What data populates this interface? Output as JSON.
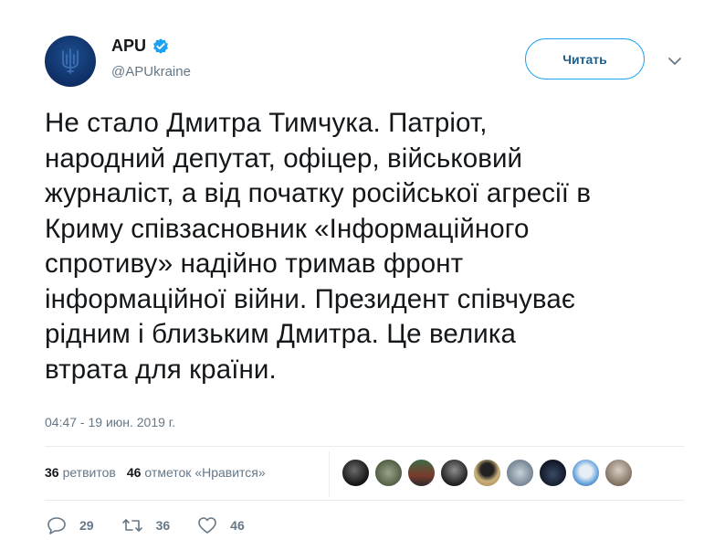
{
  "account": {
    "name": "APU",
    "handle": "@APUkraine",
    "verified": true,
    "avatar_icon": "trident-emblem-icon"
  },
  "follow_button": {
    "label": "Читать"
  },
  "tweet": {
    "text": "Не стало Дмитра Тимчука. Патріот,\nнародний депутат, офіцер, військовий\nжурналіст, а від початку російської агресії в\nКриму співзасновник «Інформаційного\nспротиву» надійно тримав фронт\nінформаційної війни. Президент співчуває\nрідним і  близьким Дмитра. Це велика\nвтрата для країни.",
    "timestamp": "04:47 - 19 июн. 2019 г."
  },
  "stats": {
    "retweets_count": "36",
    "retweets_label": "ретвитов",
    "likes_count": "46",
    "likes_label": "отметок «Нравится»"
  },
  "actions": {
    "reply_count": "29",
    "retweet_count": "36",
    "like_count": "46"
  },
  "colors": {
    "accent": "#1da1f2",
    "text": "#14171a",
    "muted": "#657786",
    "divider": "#e6ecf0"
  }
}
